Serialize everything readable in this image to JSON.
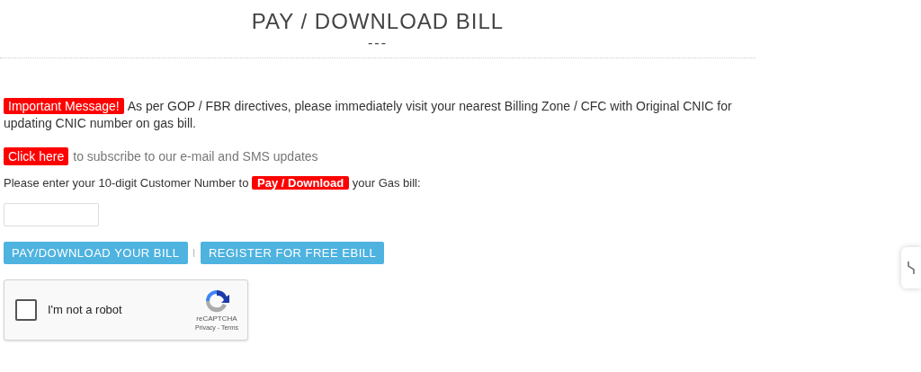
{
  "title": "PAY / DOWNLOAD BILL",
  "title_dashes": "---",
  "notice": {
    "badge": "Important Message!",
    "text": "As per GOP / FBR directives, please immediately visit your nearest Billing Zone / CFC with Original CNIC for updating CNIC number on gas bill."
  },
  "subscribe": {
    "link": "Click here",
    "text": "to subscribe to our e-mail and SMS updates"
  },
  "prompt": {
    "before": "Please enter your 10-digit Customer Number to",
    "badge": "Pay / Download",
    "after": "your Gas bill:"
  },
  "buttons": [
    "PAY/DOWNLOAD YOUR BILL",
    "REGISTER FOR FREE EBILL"
  ],
  "button_separator": "|",
  "captcha": {
    "checked": false,
    "label": "I'm not a robot",
    "brand": "reCAPTCHA",
    "links": "Privacy - Terms"
  }
}
